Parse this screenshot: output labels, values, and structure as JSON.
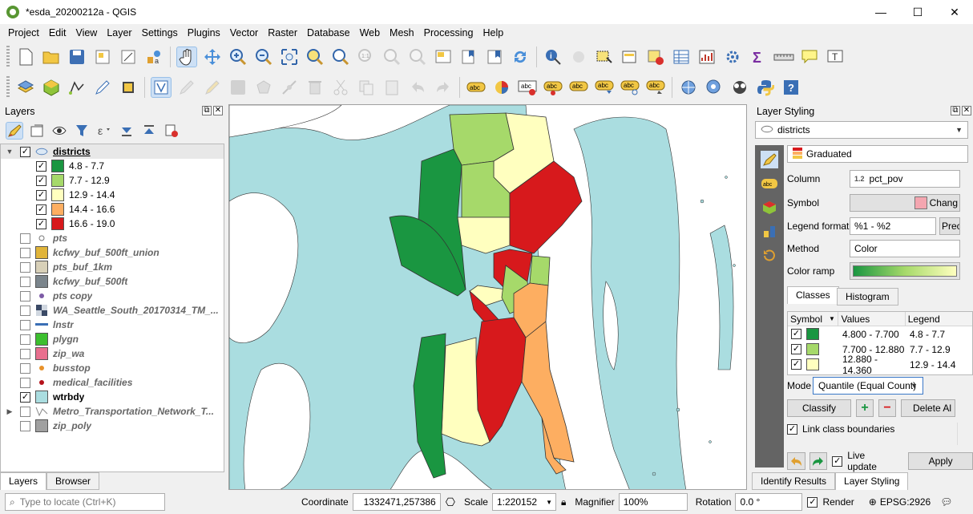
{
  "window": {
    "title": "*esda_20200212a - QGIS",
    "minimize": "—",
    "maximize": "☐",
    "close": "✕"
  },
  "menu": [
    "Project",
    "Edit",
    "View",
    "Layer",
    "Settings",
    "Plugins",
    "Vector",
    "Raster",
    "Database",
    "Web",
    "Mesh",
    "Processing",
    "Help"
  ],
  "layers_panel": {
    "title": "Layers",
    "tree": [
      {
        "name": "districts",
        "checked": true,
        "expanded": true,
        "selected": true,
        "style": "group",
        "symbol": "polygon-icon"
      },
      {
        "name": "4.8 - 7.7",
        "checked": true,
        "class": true,
        "color": "#1a9641"
      },
      {
        "name": "7.7 - 12.9",
        "checked": true,
        "class": true,
        "color": "#a6d96a"
      },
      {
        "name": "12.9 - 14.4",
        "checked": true,
        "class": true,
        "color": "#ffffbf"
      },
      {
        "name": "14.4 - 16.6",
        "checked": true,
        "class": true,
        "color": "#fdae61"
      },
      {
        "name": "16.6 - 19.0",
        "checked": true,
        "class": true,
        "color": "#d7191c"
      },
      {
        "name": "pts",
        "checked": false,
        "symbol": "point-hollow"
      },
      {
        "name": "kcfwy_buf_500ft_union",
        "checked": false,
        "color": "#e0b43a"
      },
      {
        "name": "pts_buf_1km",
        "checked": false,
        "color": "#d8d0b8"
      },
      {
        "name": "kcfwy_buf_500ft",
        "checked": false,
        "color": "#7b858c"
      },
      {
        "name": "pts copy",
        "checked": false,
        "symbol": "point-purple"
      },
      {
        "name": "WA_Seattle_South_20170314_TM_...",
        "checked": false,
        "symbol": "raster-icon"
      },
      {
        "name": "lnstr",
        "checked": false,
        "symbol": "line-blue"
      },
      {
        "name": "plygn",
        "checked": false,
        "color": "#3cbf2e"
      },
      {
        "name": "zip_wa",
        "checked": false,
        "color": "#e86f8e"
      },
      {
        "name": "busstop",
        "checked": false,
        "symbol": "point-orange"
      },
      {
        "name": "medical_facilities",
        "checked": false,
        "symbol": "point-red"
      },
      {
        "name": "wtrbdy",
        "checked": true,
        "color": "#aadde0"
      },
      {
        "name": "Metro_Transportation_Network_T...",
        "checked": false,
        "symbol": "network-icon",
        "collapsed": true
      },
      {
        "name": "zip_poly",
        "checked": false,
        "color": "#a0a0a0"
      }
    ]
  },
  "left_tabs": {
    "layers": "Layers",
    "browser": "Browser"
  },
  "style_panel": {
    "title": "Layer Styling",
    "layer": "districts",
    "renderer": "Graduated",
    "column_label": "Column",
    "column_type": "1.2",
    "column_value": "pct_pov",
    "symbol_label": "Symbol",
    "symbol_change": "Chang",
    "legend_format_label": "Legend format",
    "legend_format_value": "%1 - %2",
    "precision_btn": "Prec",
    "method_label": "Method",
    "method_value": "Color",
    "color_ramp_label": "Color ramp",
    "tab_classes": "Classes",
    "tab_histogram": "Histogram",
    "table_headers": [
      "Symbol",
      "Values",
      "Legend"
    ],
    "classes": [
      {
        "color": "#1a9641",
        "values": "4.800 - 7.700",
        "legend": "4.8 - 7.7"
      },
      {
        "color": "#a6d96a",
        "values": "7.700 - 12.880",
        "legend": "7.7 - 12.9"
      },
      {
        "color": "#ffffbf",
        "values": "12.880 - 14.360",
        "legend": "12.9 - 14.4"
      }
    ],
    "mode_label": "Mode",
    "mode_value": "Quantile (Equal Count)",
    "classify_btn": "Classify",
    "add_btn": "+",
    "remove_btn": "−",
    "delete_all_btn": "Delete Al",
    "link_boundaries": "Link class boundaries",
    "live_update": "Live update",
    "apply_btn": "Apply"
  },
  "right_tabs": {
    "identify": "Identify Results",
    "styling": "Layer Styling"
  },
  "status": {
    "locate_placeholder": "Type to locate (Ctrl+K)",
    "coordinate_label": "Coordinate",
    "coordinate_value": "1332471,257386",
    "scale_label": "Scale",
    "scale_value": "1:220152",
    "magnifier_label": "Magnifier",
    "magnifier_value": "100%",
    "rotation_label": "Rotation",
    "rotation_value": "0.0 °",
    "render_label": "Render",
    "crs": "EPSG:2926"
  },
  "colors": {
    "water": "#aadde0",
    "c1": "#1a9641",
    "c2": "#a6d96a",
    "c3": "#ffffbf",
    "c4": "#fdae61",
    "c5": "#d7191c"
  }
}
